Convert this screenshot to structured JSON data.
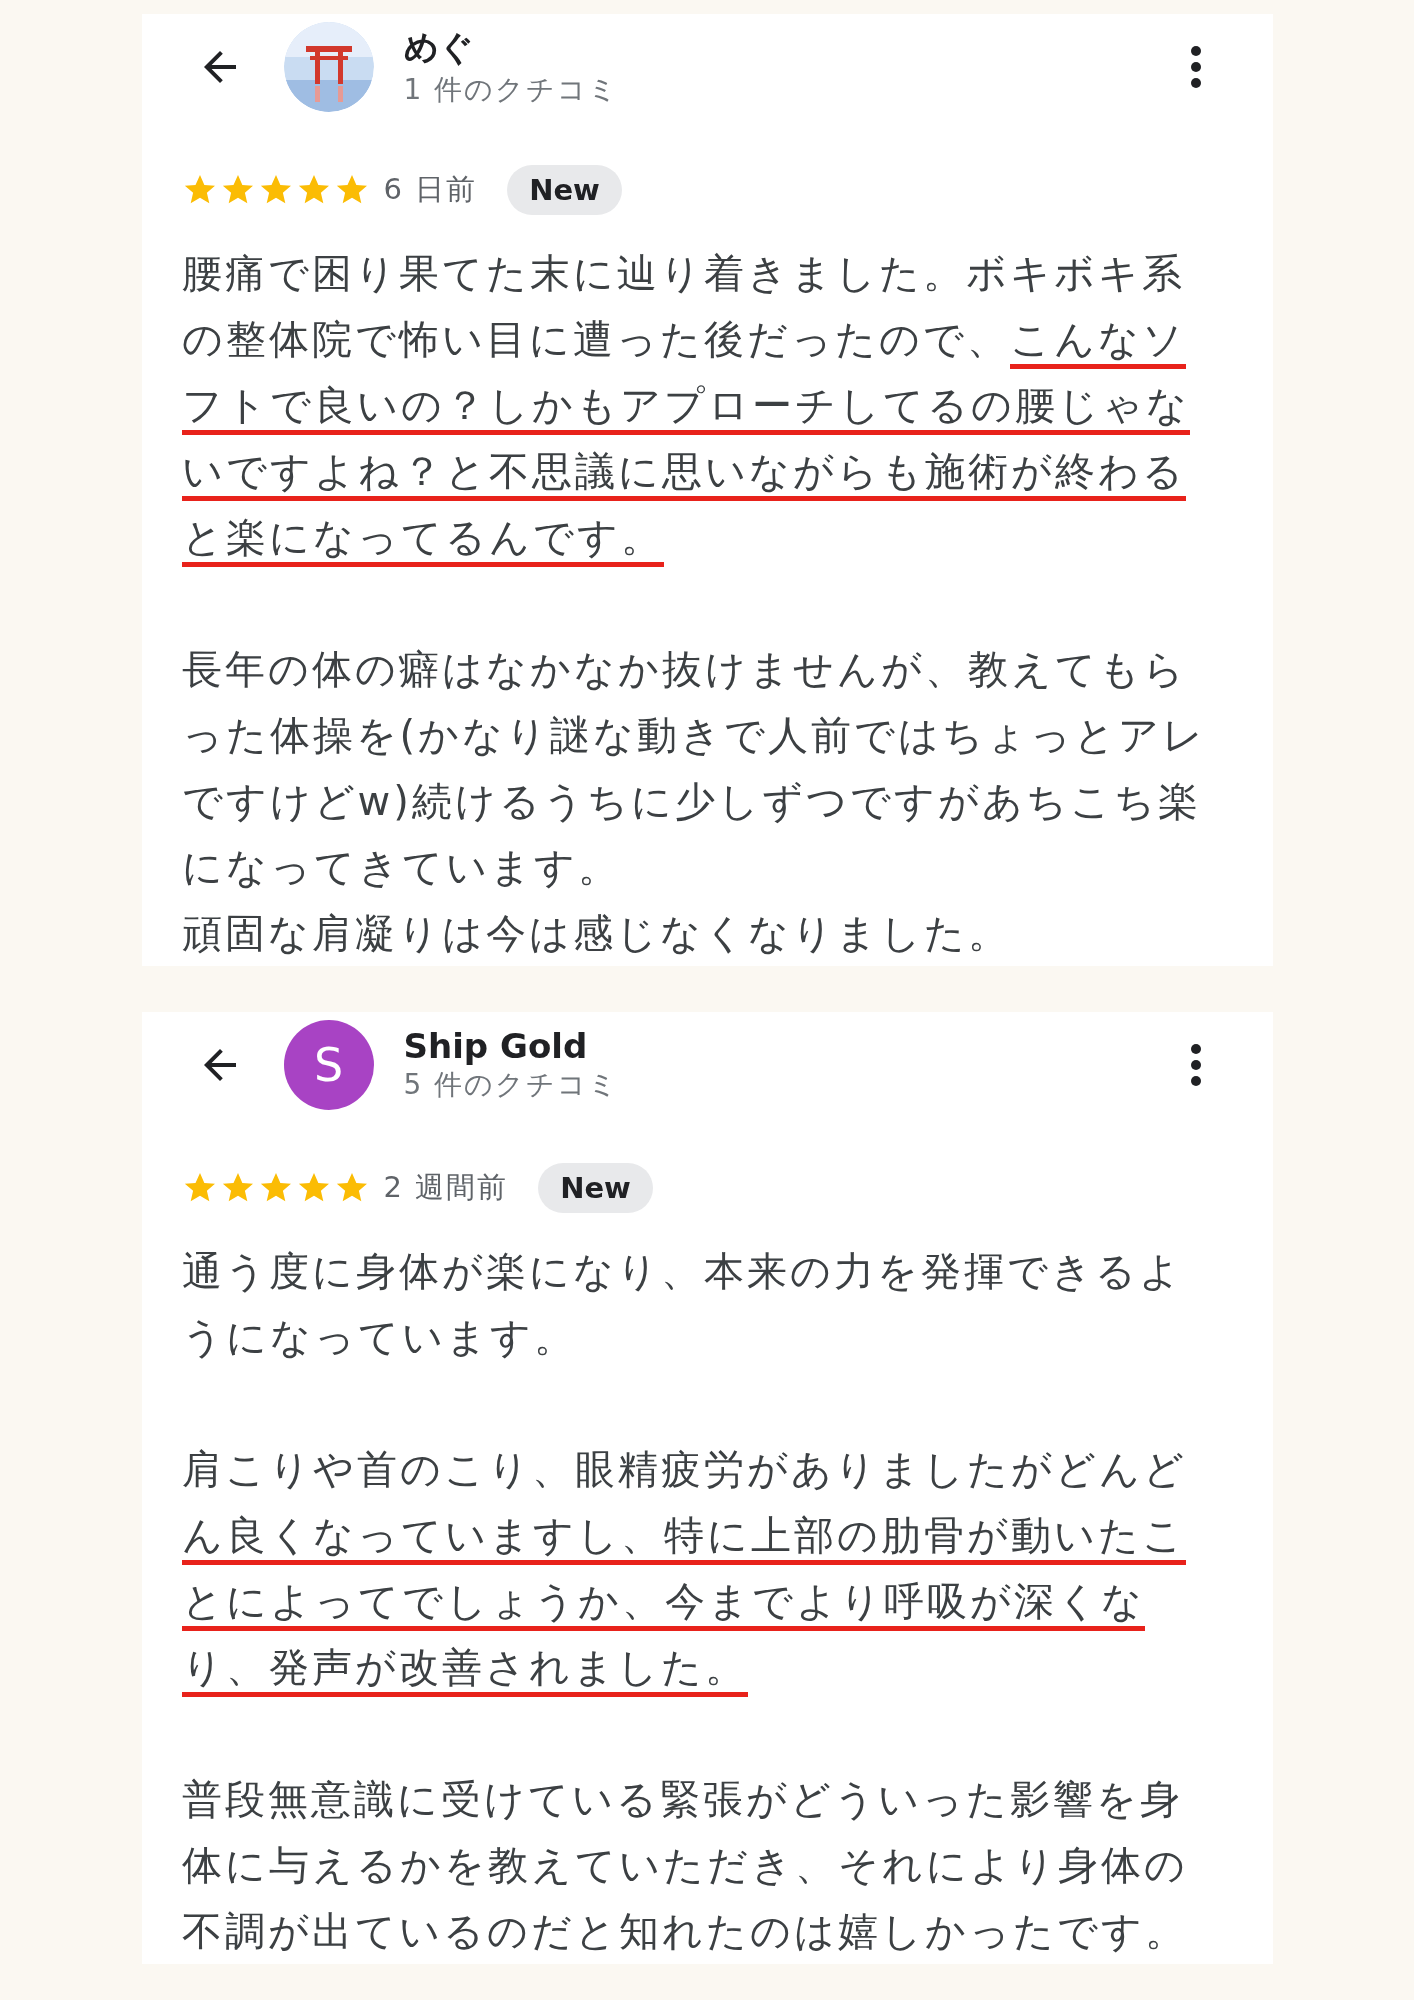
{
  "reviews": [
    {
      "author": "めぐ",
      "review_count": "1 件のクチコミ",
      "stars": 5,
      "time": "6 日前",
      "badge": "New",
      "paragraphs": [
        {
          "segments": [
            {
              "text": "腰痛で困り果てた末に辿り着きました。ボキボキ系の整体院で怖い目に遭った後だったので、",
              "underlined": false
            },
            {
              "text": "こんなソフトで良いの？しかもアプローチしてるの腰じゃないですよね？と不思議に思いながらも施術が終わると楽になってるんです。",
              "underlined": true
            }
          ]
        },
        {
          "segments": [
            {
              "text": "長年の体の癖はなかなか抜けませんが、教えてもらった体操を(かなり謎な動きで人前ではちょっとアレですけどw)続けるうちに少しずつですがあちこち楽になってきています。",
              "underlined": false
            }
          ],
          "blank_line_after": false
        },
        {
          "segments": [
            {
              "text": "頑固な肩凝りは今は感じなくなりました。",
              "underlined": false
            }
          ]
        }
      ]
    },
    {
      "author": "Ship Gold",
      "review_count": "5 件のクチコミ",
      "avatar": {
        "kind": "initial",
        "letter": "S",
        "color": "#a843c4"
      },
      "stars": 5,
      "time": "2 週間前",
      "badge": "New",
      "paragraphs": [
        {
          "segments": [
            {
              "text": "通う度に身体が楽になり、本来の力を発揮できるようになっています。",
              "underlined": false
            }
          ]
        },
        {
          "segments": [
            {
              "text": "肩こりや首のこり、眼精疲労がありましたがどんど",
              "underlined": false
            },
            {
              "text": "ん良くなっていますし、特に上部の肋骨が動いたことによってでしょうか、今までより呼吸が深くなり、発声が改善されました。",
              "underlined": true
            }
          ]
        },
        {
          "segments": [
            {
              "text": "普段無意識に受けている緊張がどういった影響を身体に与えるかを教えていただき、それにより身体の不調が出ているのだと知れたのは嬉しかったです。",
              "underlined": false
            }
          ]
        }
      ]
    }
  ]
}
